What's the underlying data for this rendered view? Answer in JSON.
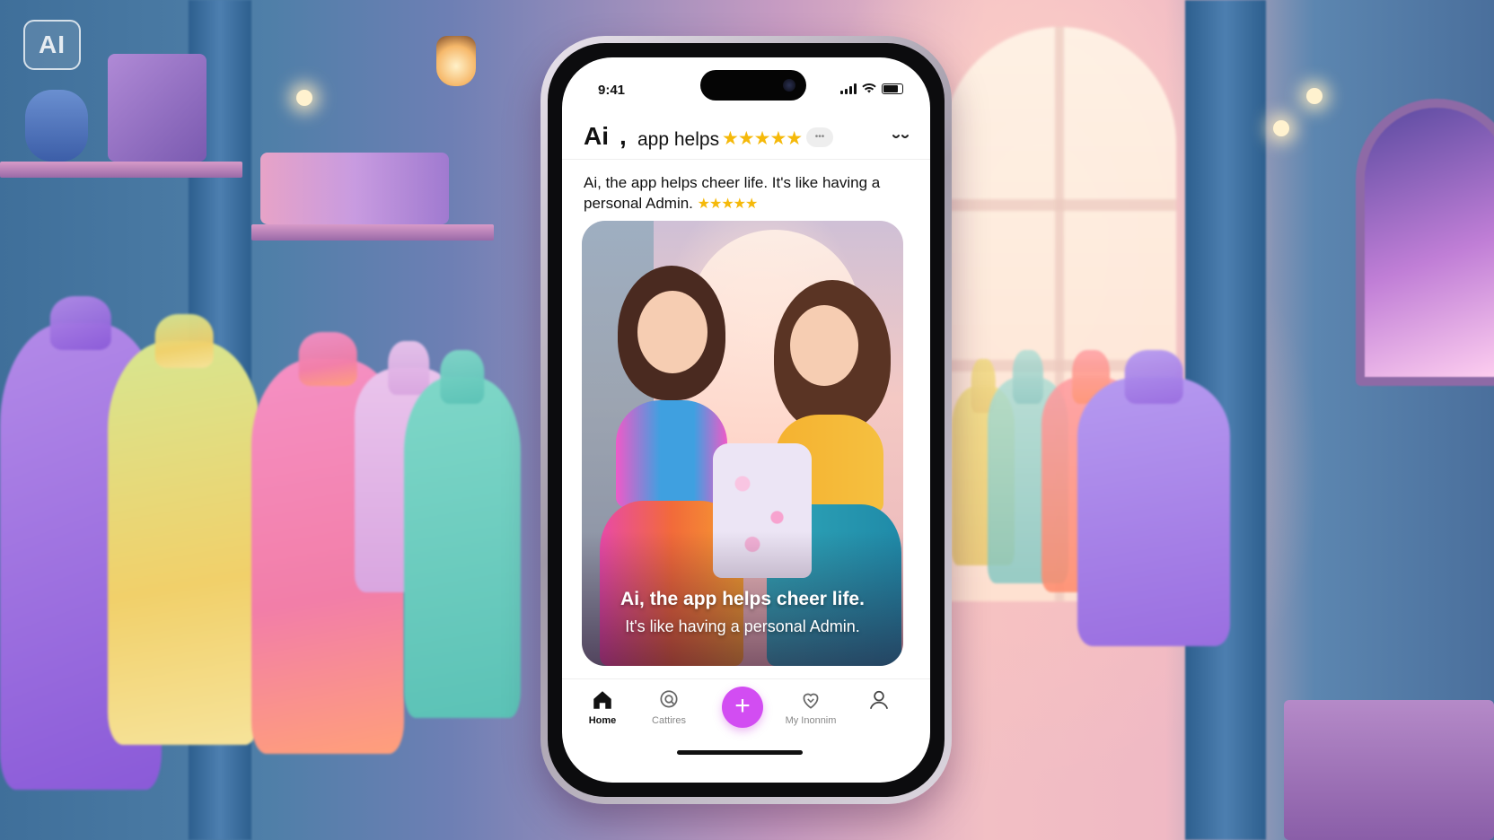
{
  "watermark": {
    "label": "AI"
  },
  "status_bar": {
    "time": "9:41"
  },
  "header": {
    "brand": "Ai",
    "separator": ",",
    "subtitle": "app helps",
    "rating_stars": "★★★★★"
  },
  "post": {
    "caption": "Ai, the app helps cheer life. It's like having a personal Admin.",
    "caption_stars": "★★★★★",
    "image_title": "Ai, the app helps cheer life.",
    "image_subtitle": "It's like having a personal Admin."
  },
  "tabbar": {
    "items": [
      {
        "label": "Home",
        "icon": "home-icon",
        "active": true
      },
      {
        "label": "Cattires",
        "icon": "search-icon",
        "active": false
      },
      {
        "label": "",
        "icon": "plus-icon",
        "active": false
      },
      {
        "label": "My Inonnim",
        "icon": "heart-icon",
        "active": false
      },
      {
        "label": "",
        "icon": "profile-icon",
        "active": false
      }
    ],
    "fab_symbol": "+"
  },
  "colors": {
    "accent": "#d24df2",
    "stars": "#f5b90a"
  }
}
